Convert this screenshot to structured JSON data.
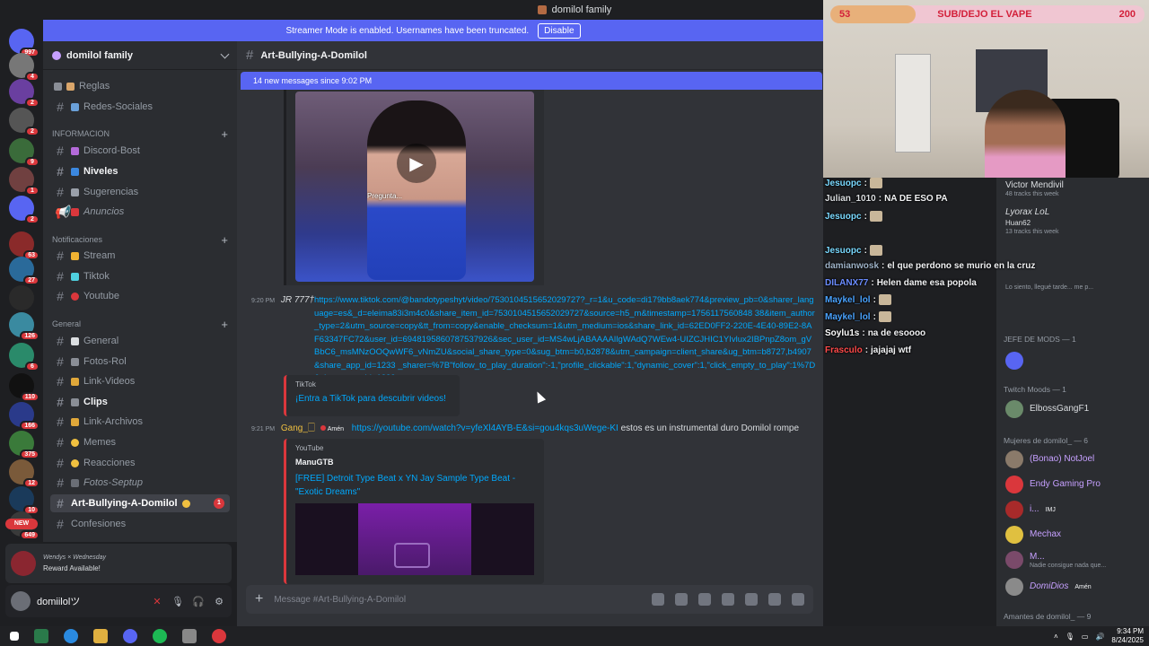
{
  "window": {
    "title": "domilol family"
  },
  "banner": {
    "text": "Streamer Mode is enabled. Usernames have been truncated.",
    "disable_label": "Disable"
  },
  "servers": [
    {
      "badge": "997",
      "color": "#5865f2"
    },
    {
      "badge": "4",
      "color": "#777"
    },
    {
      "badge": "2",
      "color": "#6a3fa0"
    },
    {
      "badge": "2",
      "color": "#555"
    },
    {
      "badge": "9",
      "color": "#3a6b3a"
    },
    {
      "badge": "1",
      "color": "#704040"
    },
    {
      "badge": "2",
      "color": "#5865f2"
    },
    {
      "badge": "63",
      "color": "#8a2a2a"
    },
    {
      "badge": "27",
      "color": "#2a6a9a"
    },
    {
      "badge": "",
      "color": "#2a2a2a"
    },
    {
      "badge": "126",
      "color": "#3a8aa0"
    },
    {
      "badge": "6",
      "color": "#2a8a6a"
    },
    {
      "badge": "110",
      "color": "#111"
    },
    {
      "badge": "166",
      "color": "#2a3a8a"
    },
    {
      "badge": "375",
      "color": "#3a7a3a"
    },
    {
      "badge": "12",
      "color": "#7a5a3a"
    },
    {
      "badge": "10",
      "color": "#1a3a5a"
    },
    {
      "badge": "649",
      "color": "#3a3a3a",
      "new_label": "NEW"
    }
  ],
  "guild": {
    "name": "domilol family"
  },
  "channels": {
    "top": [
      {
        "label": "Reglas"
      },
      {
        "label": "Redes-Sociales"
      }
    ],
    "cat_info": "INFORMACION",
    "info": [
      {
        "label": "Discord-Bost"
      },
      {
        "label": "Niveles"
      },
      {
        "label": "Sugerencias"
      },
      {
        "label": "Anuncios"
      }
    ],
    "cat_notif": "Notificaciones",
    "notif": [
      {
        "label": "Stream"
      },
      {
        "label": "Tiktok"
      },
      {
        "label": "Youtube"
      }
    ],
    "cat_general": "General",
    "general": [
      {
        "label": "General"
      },
      {
        "label": "Fotos-Rol"
      },
      {
        "label": "Link-Videos"
      },
      {
        "label": "Clips"
      },
      {
        "label": "Link-Archivos"
      },
      {
        "label": "Memes"
      },
      {
        "label": "Reacciones"
      },
      {
        "label": "Fotos-Septup"
      },
      {
        "label": "Art-Bullying-A-Domilol",
        "unread": "1"
      },
      {
        "label": "Confesiones"
      }
    ]
  },
  "reward": {
    "line1": "Wendys × Wednesday",
    "line2": "Reward Available!"
  },
  "user": {
    "name": "domiilolツ"
  },
  "chat": {
    "channel": "Art-Bullying-A-Domilol",
    "new_messages": "14 new messages since 9:02 PM",
    "video_caption": "Pregunta...",
    "msg1": {
      "time": "9:20 PM",
      "author": "JR 777†",
      "link": "https://www.tiktok.com/@bandotypeshyt/video/7530104515652029727?_r=1&u_code=di179bb8aek774&preview_pb=0&sharer_language=es&_d=eleima83i3m4c0&share_item_id=7530104515652029727&source=h5_m&timestamp=1756117560848 38&item_author_type=2&utm_source=copy&tt_from=copy&enable_checksum=1&utm_medium=ios&share_link_id=62ED0FF2-220E-4E40-89E2-8AF63347FC72&user_id=6948195860787537926&sec_user_id=MS4wLjABAAAAIlgWAdQ7WEw4-UIZCJHIC1YIvlux2IBPnpZ8om_gVBbC6_msMNzOOQwWF6_vNmZU&social_share_type=0&sug_btm=b0,b2878&utm_campaign=client_share&ug_btm=b8727,b4907&share_app_id=1233 _sharer=%7B\"follow_to_play_duration\":-1,\"profile_clickable\":1,\"dynamic_cover\":1,\"click_empty_to_play\":1%7D&share_app_id=1233",
      "embed_provider": "TikTok",
      "embed_title": "¡Entra a TikTok para descubrir videos!"
    },
    "msg2": {
      "time": "9:21 PM",
      "author": "Gang_🗌",
      "role": "Amén",
      "link": "https://youtube.com/watch?v=yfeXl4AYB-E&si=gou4kqs3uWege-KI",
      "text": "estos es un instrumental duro Domilol rompe",
      "embed_provider": "YouTube",
      "embed_author": "ManuGTB",
      "embed_title": "[FREE] Detroit Type Beat x YN Jay Sample Type Beat - \"Exotic Dreams\""
    },
    "composer_placeholder": "Message #Art-Bullying-A-Domilol"
  },
  "webcam": {
    "left_count": "53",
    "goal_text": "SUB/DEJO EL VAPE",
    "right_count": "200",
    "progress_fraction": 0.27
  },
  "overlay_chat": [
    {
      "user": "Jesuopc",
      "text": "",
      "color": "#7ad9ff",
      "emote": true
    },
    {
      "user": "Julian_1010",
      "text": "NA DE ESO PA",
      "color": "#dbdee1",
      "emote": false
    },
    {
      "user": "Jesuopc",
      "text": "",
      "color": "#7ad9ff",
      "emote": true
    },
    {
      "user": "Jesuopc",
      "text": "",
      "color": "#7ad9ff",
      "emote": true
    },
    {
      "user": "damianwosk",
      "text": "el que perdono se murio en la cruz",
      "color": "#9fb3c8",
      "emote": false
    },
    {
      "user": "DILANX77",
      "text": "Helen dame esa popola",
      "color": "#6a8cff",
      "emote": false
    },
    {
      "user": "Maykel_lol",
      "text": "",
      "color": "#4aa3ff",
      "emote": true
    },
    {
      "user": "Maykel_lol",
      "text": "",
      "color": "#4aa3ff",
      "emote": true
    },
    {
      "user": "Soylu1s",
      "text": "na de esoooo",
      "color": "#ffffff",
      "emote": false
    },
    {
      "user": "Frasculo",
      "text": "jajajaj wtf",
      "color": "#ff4a4a",
      "emote": false
    }
  ],
  "members": {
    "activity": [
      {
        "name": "Victor Mendivil",
        "sub": "48 tracks this week"
      },
      {
        "name": "Lyorax LoL",
        "sub": ""
      },
      {
        "name": "Huan62",
        "sub": "13 tracks this week"
      },
      {
        "name": "",
        "sub": "Lo siento, llegué tarde... me p..."
      }
    ],
    "cat_jefe": "JEFE DE MODS — 1",
    "cat_twitch": "Twitch Moods — 1",
    "twitch": [
      {
        "name": "ElbossGangF1"
      }
    ],
    "cat_mujeres": "Mujeres de domilol_ — 6",
    "mujeres": [
      {
        "name": "(Bonao) NotJoel",
        "sub": ""
      },
      {
        "name": "Endy Gaming Pro",
        "sub": ""
      },
      {
        "name": "i...",
        "sub": ""
      },
      {
        "name": "Mechax",
        "sub": ""
      },
      {
        "name": "M...",
        "sub": "Nadie consigue nada que..."
      },
      {
        "name": "DomiDios",
        "sub": ""
      }
    ],
    "role_tag": "IMJ",
    "role_tag2": "Amén",
    "cat_amantes": "Amantes de domilol_ — 9"
  },
  "taskbar": {
    "time": "9:34 PM",
    "date": "8/24/2025"
  }
}
